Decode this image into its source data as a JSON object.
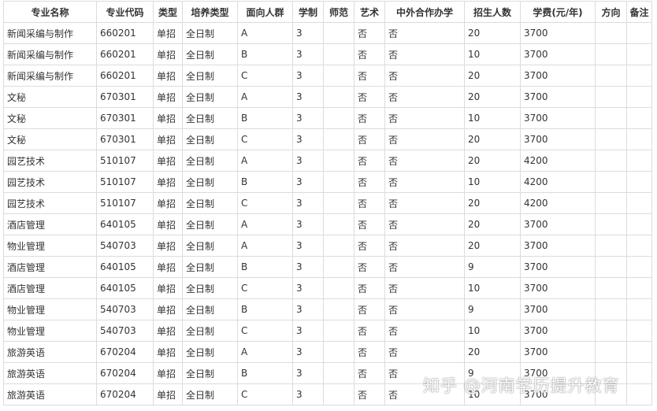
{
  "headers": [
    "专业名称",
    "专业代码",
    "类型",
    "培养类型",
    "面向人群",
    "学制",
    "师范",
    "艺术",
    "中外合作办学",
    "招生人数",
    "学费(元/年)",
    "方向",
    "备注"
  ],
  "rows": [
    [
      "新闻采编与制作",
      "660201",
      "单招",
      "全日制",
      "A",
      "3",
      "",
      "否",
      "否",
      "20",
      "3700",
      "",
      ""
    ],
    [
      "新闻采编与制作",
      "660201",
      "单招",
      "全日制",
      "B",
      "3",
      "",
      "否",
      "否",
      "10",
      "3700",
      "",
      ""
    ],
    [
      "新闻采编与制作",
      "660201",
      "单招",
      "全日制",
      "C",
      "3",
      "",
      "否",
      "否",
      "20",
      "3700",
      "",
      ""
    ],
    [
      "文秘",
      "670301",
      "单招",
      "全日制",
      "A",
      "3",
      "",
      "否",
      "否",
      "20",
      "3700",
      "",
      ""
    ],
    [
      "文秘",
      "670301",
      "单招",
      "全日制",
      "B",
      "3",
      "",
      "否",
      "否",
      "10",
      "3700",
      "",
      ""
    ],
    [
      "文秘",
      "670301",
      "单招",
      "全日制",
      "C",
      "3",
      "",
      "否",
      "否",
      "20",
      "3700",
      "",
      ""
    ],
    [
      "园艺技术",
      "510107",
      "单招",
      "全日制",
      "A",
      "3",
      "",
      "否",
      "否",
      "20",
      "4200",
      "",
      ""
    ],
    [
      "园艺技术",
      "510107",
      "单招",
      "全日制",
      "B",
      "3",
      "",
      "否",
      "否",
      "10",
      "4200",
      "",
      ""
    ],
    [
      "园艺技术",
      "510107",
      "单招",
      "全日制",
      "C",
      "3",
      "",
      "否",
      "否",
      "20",
      "4200",
      "",
      ""
    ],
    [
      "酒店管理",
      "640105",
      "单招",
      "全日制",
      "A",
      "3",
      "",
      "否",
      "否",
      "20",
      "3700",
      "",
      ""
    ],
    [
      "物业管理",
      "540703",
      "单招",
      "全日制",
      "A",
      "3",
      "",
      "否",
      "否",
      "20",
      "3700",
      "",
      ""
    ],
    [
      "酒店管理",
      "640105",
      "单招",
      "全日制",
      "B",
      "3",
      "",
      "否",
      "否",
      "9",
      "3700",
      "",
      ""
    ],
    [
      "酒店管理",
      "640105",
      "单招",
      "全日制",
      "C",
      "3",
      "",
      "否",
      "否",
      "10",
      "3700",
      "",
      ""
    ],
    [
      "物业管理",
      "540703",
      "单招",
      "全日制",
      "B",
      "3",
      "",
      "否",
      "否",
      "9",
      "3700",
      "",
      ""
    ],
    [
      "物业管理",
      "540703",
      "单招",
      "全日制",
      "C",
      "3",
      "",
      "否",
      "否",
      "10",
      "3700",
      "",
      ""
    ],
    [
      "旅游英语",
      "670204",
      "单招",
      "全日制",
      "A",
      "3",
      "",
      "否",
      "否",
      "20",
      "3700",
      "",
      ""
    ],
    [
      "旅游英语",
      "670204",
      "单招",
      "全日制",
      "B",
      "3",
      "",
      "否",
      "否",
      "9",
      "3700",
      "",
      ""
    ],
    [
      "旅游英语",
      "670204",
      "单招",
      "全日制",
      "C",
      "3",
      "",
      "否",
      "否",
      "10",
      "3700",
      "",
      ""
    ]
  ],
  "watermark": "知乎 @河南学历提升教育"
}
